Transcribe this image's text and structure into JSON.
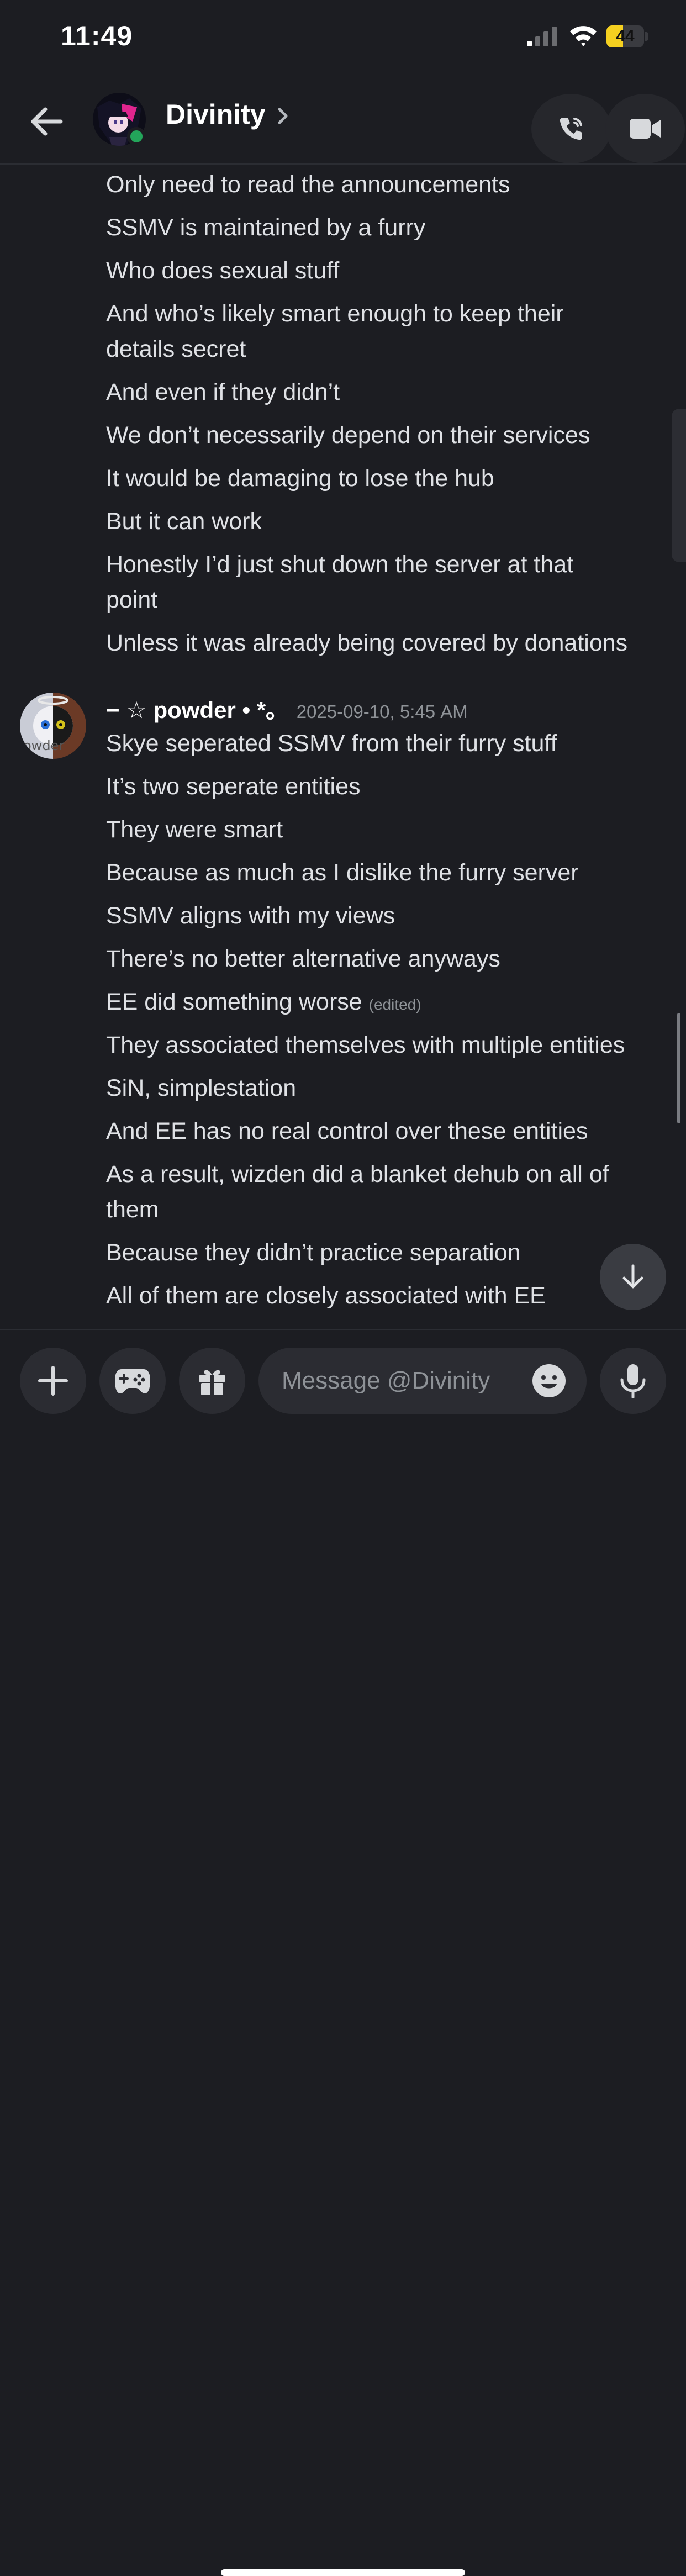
{
  "status_bar": {
    "time": "11:49",
    "battery_level": "44",
    "battery_fraction": 0.44
  },
  "header": {
    "title": "Divinity"
  },
  "messages": {
    "lines_top": [
      "Only need to read the announcements",
      "SSMV is maintained by a furry",
      "Who does sexual stuff",
      "And who’s likely smart enough to keep their",
      "details secret",
      "And even if they didn’t",
      "We don’t necessarily depend on their services",
      "It would be damaging to lose the hub",
      "But it can work",
      "Honestly I’d just shut down the server at that",
      "point",
      "Unless it was already being covered by donations"
    ],
    "author": "− ☆ powder • *｡",
    "timestamp": "2025-09-10, 5:45 AM",
    "lines_bottom": [
      "Skye seperated SSMV from their furry stuff",
      "It’s two seperate entities",
      "They were smart",
      "Because as much as I dislike the furry server",
      "SSMV aligns with my views",
      "There’s no better alternative anyways",
      "EE did something worse",
      "They associated themselves with multiple entities",
      "SiN, simplestation",
      "And EE has no real control over these entities",
      "As a result, wizden did a blanket dehub on all of",
      "them",
      "Because they didn’t practice separation",
      "All of them are closely associated with EE"
    ],
    "edited_label": "(edited)",
    "avatar_text": "owder"
  },
  "composer": {
    "placeholder": "Message @Divinity"
  },
  "colors": {
    "background": "#1c1d22",
    "online": "#23a55a",
    "battery": "#f5d020"
  }
}
